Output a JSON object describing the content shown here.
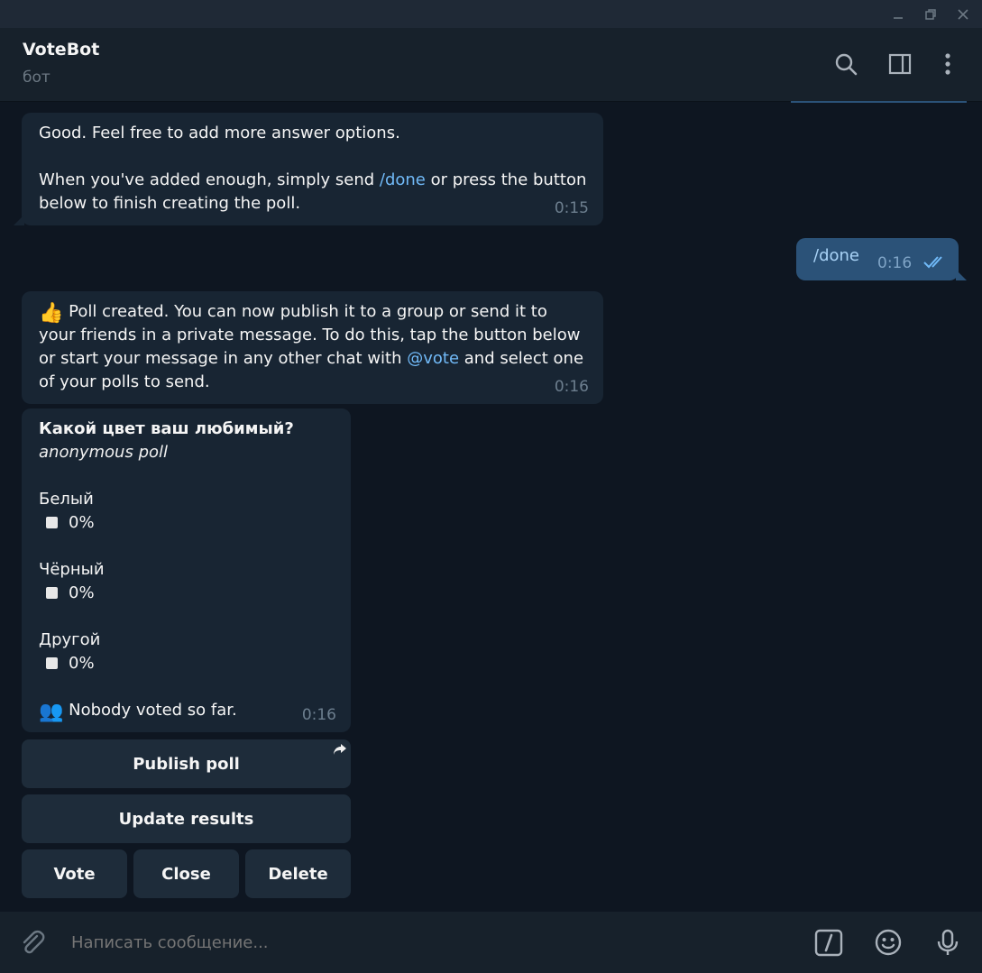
{
  "window": {
    "buttons": [
      "minimize",
      "restore",
      "close"
    ]
  },
  "header": {
    "title": "VoteBot",
    "subtitle": "бот",
    "icons": [
      "search-icon",
      "sidebar-toggle-icon",
      "more-vert-icon"
    ]
  },
  "messages": {
    "m1": {
      "line1": "Good. Feel free to add more answer options.",
      "line2_pre": "When you've added enough, simply send ",
      "line2_link": "/done",
      "line2_post": " or press the button",
      "line3": "below to finish creating the poll.",
      "time": "0:15"
    },
    "m2": {
      "text": "/done",
      "time": "0:16"
    },
    "m3": {
      "emoji": "👍",
      "line1": " Poll created. You can now publish it to a group or send it to",
      "line2": "your friends in a private message. To do this, tap the button below",
      "line3_pre": "or start your message in any other chat with ",
      "line3_link": "@vote",
      "line3_post": " and select one",
      "line4": "of your polls to send.",
      "time": "0:16"
    },
    "poll": {
      "question": "Какой цвет ваш любимый?",
      "subtitle": "anonymous poll",
      "options": [
        {
          "label": "Белый",
          "percent": "0%"
        },
        {
          "label": "Чёрный",
          "percent": "0%"
        },
        {
          "label": "Другой",
          "percent": "0%"
        }
      ],
      "footer_emoji": "👥",
      "footer": " Nobody voted so far.",
      "time": "0:16"
    }
  },
  "keyboard": {
    "publish": "Publish poll",
    "update": "Update results",
    "vote": "Vote",
    "close": "Close",
    "delete": "Delete"
  },
  "composer": {
    "placeholder": "Написать сообщение...",
    "icons": [
      "attach-icon",
      "bot-command-icon",
      "emoji-icon",
      "microphone-icon"
    ]
  },
  "colors": {
    "background": "#0e1621",
    "header": "#17212b",
    "incoming_bubble": "#182533",
    "outgoing_bubble": "#2b5278",
    "link": "#71baf8",
    "secondary_text": "#6c7883"
  }
}
